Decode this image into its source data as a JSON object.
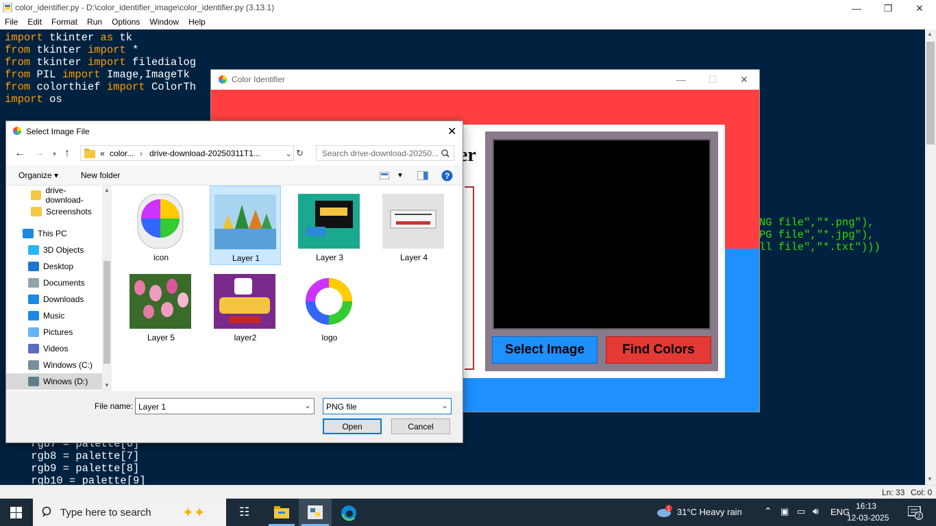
{
  "idle": {
    "title": "color_identifier.py - D:\\color_identifier_image\\color_identifier.py (3.13.1)",
    "menu": [
      "File",
      "Edit",
      "Format",
      "Run",
      "Options",
      "Window",
      "Help"
    ],
    "code_top": [
      [
        [
          "kw",
          "import"
        ],
        [
          "id",
          " tkinter "
        ],
        [
          "kw",
          "as"
        ],
        [
          "id",
          " tk"
        ]
      ],
      [
        [
          "kw",
          "from"
        ],
        [
          "id",
          " tkinter "
        ],
        [
          "kw",
          "import"
        ],
        [
          "id",
          " *"
        ]
      ],
      [
        [
          "kw",
          "from"
        ],
        [
          "id",
          " tkinter "
        ],
        [
          "kw",
          "import"
        ],
        [
          "id",
          " filedialog"
        ]
      ],
      [
        [
          "kw",
          "from"
        ],
        [
          "id",
          " PIL "
        ],
        [
          "kw",
          "import"
        ],
        [
          "id",
          " Image,ImageTk"
        ]
      ],
      [
        [
          "kw",
          "from"
        ],
        [
          "id",
          " colorthief "
        ],
        [
          "kw",
          "import"
        ],
        [
          "id",
          " ColorTh"
        ]
      ],
      [
        [
          "kw",
          "import"
        ],
        [
          "id",
          " os"
        ]
      ]
    ],
    "code_right": [
      "NG file\",\"*.png\"),",
      "PG file\",\"*.jpg\"),",
      "ll file\",\"*.txt\")))"
    ],
    "code_bottom": [
      "    rgb7 = palette[6]",
      "    rgb8 = palette[7]",
      "    rgb9 = palette[8]",
      "    rgb10 = palette[9]"
    ],
    "status": {
      "line": "Ln: 33",
      "col": "Col: 0"
    }
  },
  "color_identifier": {
    "title": "Color Identifier",
    "heading_fragment": "er",
    "select_button": "Select Image",
    "find_button": "Find Colors"
  },
  "dialog": {
    "title": "Select Image File",
    "address": {
      "prefix": "«",
      "seg1": "color...",
      "seg2": "drive-download-20250311T1..."
    },
    "search_placeholder": "Search drive-download-20250...",
    "organize": "Organize ▾",
    "new_folder": "New folder",
    "nav": [
      {
        "label": "drive-download-",
        "icon": "folder-icon",
        "color": "#f5c842"
      },
      {
        "label": "Screenshots",
        "icon": "folder-icon",
        "color": "#f5c842"
      },
      {
        "label": "This PC",
        "icon": "computer-icon",
        "color": "#1e88e5"
      },
      {
        "label": "3D Objects",
        "icon": "cube-icon",
        "color": "#29b6f6"
      },
      {
        "label": "Desktop",
        "icon": "desktop-icon",
        "color": "#1976d2"
      },
      {
        "label": "Documents",
        "icon": "document-icon",
        "color": "#90a4ae"
      },
      {
        "label": "Downloads",
        "icon": "download-icon",
        "color": "#1e88e5"
      },
      {
        "label": "Music",
        "icon": "music-icon",
        "color": "#1e88e5"
      },
      {
        "label": "Pictures",
        "icon": "pictures-icon",
        "color": "#64b5f6"
      },
      {
        "label": "Videos",
        "icon": "video-icon",
        "color": "#5c6bc0"
      },
      {
        "label": "Windows (C:)",
        "icon": "drive-icon",
        "color": "#78909c"
      },
      {
        "label": "Winows (D:)",
        "icon": "drive-icon",
        "color": "#607d8b"
      }
    ],
    "files": [
      {
        "label": "icon",
        "kind": "color-wheel-icon"
      },
      {
        "label": "Layer 1",
        "kind": "landscape-thumbnail"
      },
      {
        "label": "Layer 3",
        "kind": "subscribe-thumbnail"
      },
      {
        "label": "Layer 4",
        "kind": "thanks-thumbnail"
      },
      {
        "label": "Layer 5",
        "kind": "tulips-thumbnail"
      },
      {
        "label": "layer2",
        "kind": "ludo-thumbnail"
      },
      {
        "label": "logo",
        "kind": "color-ring-icon"
      }
    ],
    "file_name_label": "File name:",
    "file_name_value": "Layer 1",
    "file_type_value": "PNG file",
    "open_button": "Open",
    "cancel_button": "Cancel"
  },
  "taskbar": {
    "search_placeholder": "Type here to search",
    "weather": "31°C  Heavy rain",
    "language": "ENG",
    "time": "16:13",
    "date": "12-03-2025",
    "notifications": "2",
    "weather_badge": "1"
  }
}
